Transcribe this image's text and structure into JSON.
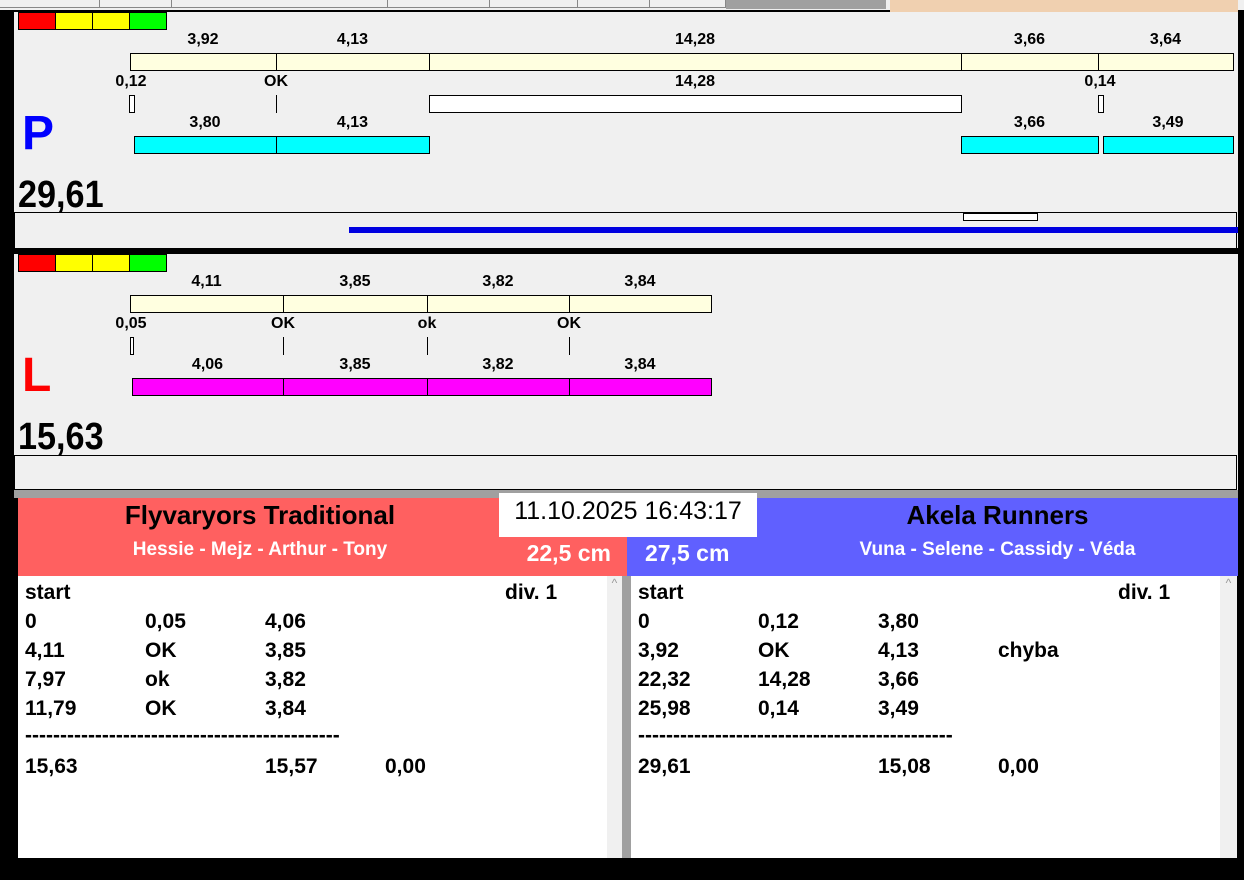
{
  "traffic_colors": [
    "#ff0000",
    "#ffff00",
    "#ffff00",
    "#00ff00"
  ],
  "p_lane": {
    "letter": "P",
    "letter_color": "#0000ff",
    "total": "29,61",
    "row1": [
      "3,92",
      "4,13",
      "14,28",
      "3,66",
      "3,64"
    ],
    "row2": [
      "0,12",
      "OK",
      "14,28",
      "0,14"
    ],
    "row3": [
      "3,80",
      "4,13",
      "3,66",
      "3,49"
    ],
    "row1_color": "#ffffe0",
    "row3_color": "#00ffff",
    "progress_color": "#0000e0"
  },
  "l_lane": {
    "letter": "L",
    "letter_color": "#ff0000",
    "total": "15,63",
    "row1": [
      "4,11",
      "3,85",
      "3,82",
      "3,84"
    ],
    "row2": [
      "0,05",
      "OK",
      "ok",
      "OK"
    ],
    "row3": [
      "4,06",
      "3,85",
      "3,82",
      "3,84"
    ],
    "row1_color": "#ffffe0",
    "row3_color": "#ff00ff"
  },
  "timestamp": "11.10.2025 16:43:17",
  "left_team": {
    "name": "Flyvaryors Traditional",
    "members": "Hessie - Mejz - Arthur - Tony",
    "distance": "22,5 cm",
    "color": "#ff6060",
    "list": {
      "header": [
        "start",
        "div.  1"
      ],
      "rows": [
        [
          "0",
          "0,05",
          "4,06",
          ""
        ],
        [
          "4,11",
          "OK",
          "3,85",
          ""
        ],
        [
          "7,97",
          "ok",
          "3,82",
          ""
        ],
        [
          "11,79",
          "OK",
          "3,84",
          ""
        ]
      ],
      "divider": "---------------------------------------------",
      "total": [
        "15,63",
        "",
        "15,57",
        "0,00"
      ]
    }
  },
  "right_team": {
    "name": "Akela Runners",
    "members": "Vuna - Selene - Cassidy - Véda",
    "distance": "27,5 cm",
    "color": "#6060ff",
    "list": {
      "header": [
        "start",
        "div.  1"
      ],
      "rows": [
        [
          "0",
          "0,12",
          "3,80",
          ""
        ],
        [
          "3,92",
          "OK",
          "4,13",
          "chyba"
        ],
        [
          "22,32",
          "14,28",
          "3,66",
          ""
        ],
        [
          "25,98",
          "0,14",
          "3,49",
          ""
        ]
      ],
      "divider": "---------------------------------------------",
      "total": [
        "29,61",
        "",
        "15,08",
        "0,00"
      ]
    }
  }
}
